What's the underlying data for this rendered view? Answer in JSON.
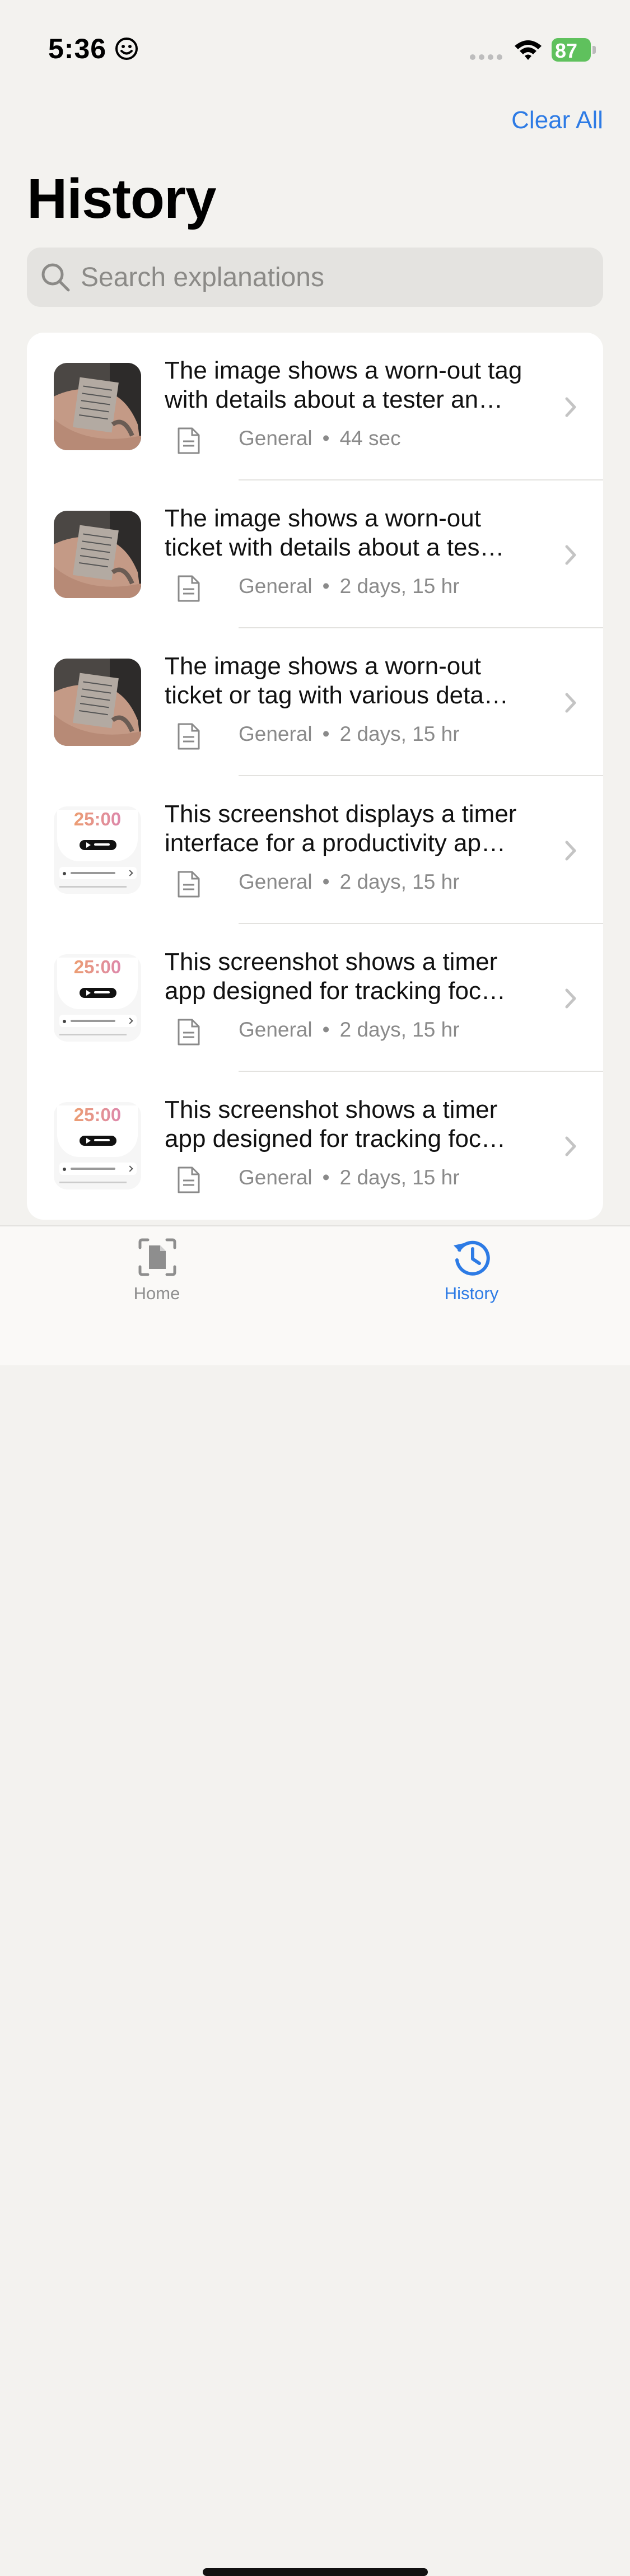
{
  "status_bar": {
    "time": "5:36",
    "battery": "87"
  },
  "header": {
    "clear_all_label": "Clear All",
    "title": "History"
  },
  "search": {
    "placeholder": "Search explanations"
  },
  "history_items": [
    {
      "thumbnail": "photo-tag",
      "title_line1": "The image shows a worn-out tag",
      "title_line2": "with details about a tester an…",
      "category": "General",
      "separator": "•",
      "age": "44 sec"
    },
    {
      "thumbnail": "photo-tag",
      "title_line1": "The image shows a worn-out",
      "title_line2": "ticket with details about a tes…",
      "category": "General",
      "separator": "•",
      "age": "2 days, 15 hr"
    },
    {
      "thumbnail": "photo-tag",
      "title_line1": "The image shows a worn-out",
      "title_line2": "ticket or tag with various deta…",
      "category": "General",
      "separator": "•",
      "age": "2 days, 15 hr"
    },
    {
      "thumbnail": "timer-screenshot",
      "thumb_text": "25:00",
      "title_line1": "This screenshot displays a timer",
      "title_line2": "interface for a productivity ap…",
      "category": "General",
      "separator": "•",
      "age": "2 days, 15 hr"
    },
    {
      "thumbnail": "timer-screenshot",
      "thumb_text": "25:00",
      "title_line1": "This screenshot shows a timer",
      "title_line2": "app designed for tracking foc…",
      "category": "General",
      "separator": "•",
      "age": "2 days, 15 hr"
    },
    {
      "thumbnail": "timer-screenshot",
      "thumb_text": "25:00",
      "title_line1": "This screenshot shows a timer",
      "title_line2": "app designed for tracking foc…",
      "category": "General",
      "separator": "•",
      "age": "2 days, 15 hr"
    }
  ],
  "tab_bar": {
    "tabs": [
      {
        "label": "Home",
        "icon": "scan-document-icon",
        "selected": false
      },
      {
        "label": "History",
        "icon": "clock-history-icon",
        "selected": true
      }
    ]
  },
  "colors": {
    "accent": "#2d7be5",
    "background": "#f3f2ef",
    "battery": "#5fc15d"
  }
}
